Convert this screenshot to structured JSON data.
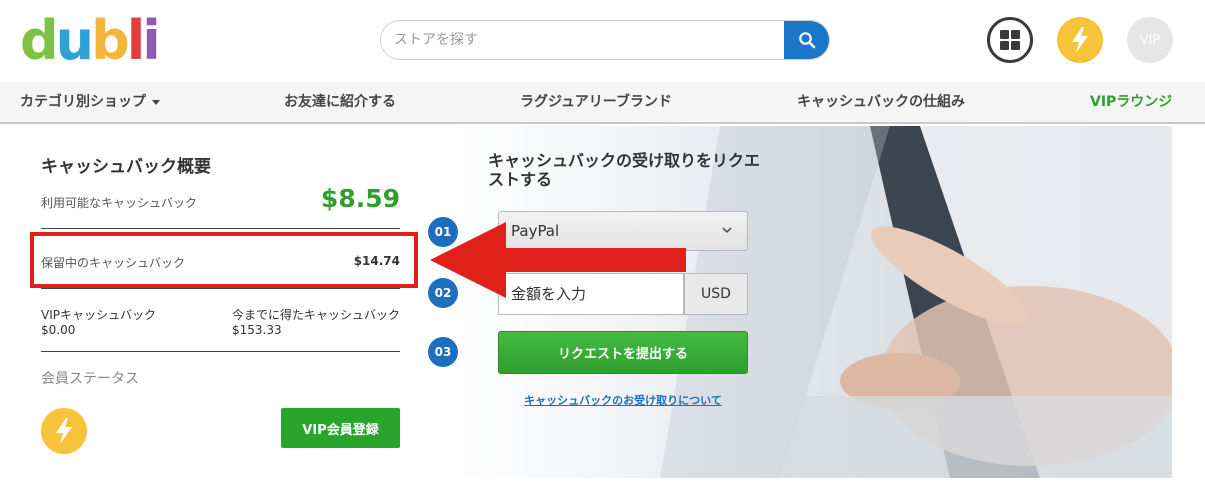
{
  "header": {
    "logo": [
      "d",
      "u",
      "b",
      "l",
      "i"
    ],
    "logo_colors": [
      "#7dc242",
      "#2fa0d8",
      "#f4b63a",
      "#e23c3c",
      "#8e5bb0"
    ],
    "search": {
      "placeholder": "ストアを探す"
    },
    "icons": [
      "search-icon",
      "grid-icon",
      "bolt-icon"
    ],
    "vip_label": "VIP"
  },
  "nav": {
    "items": [
      "カテゴリ別ショップ",
      "お友達に紹介する",
      "ラグジュアリーブランド",
      "キャッシュバックの仕組み",
      "VIPラウンジ"
    ]
  },
  "summary": {
    "title": "キャッシュバック概要",
    "available_label": "利用可能なキャッシュバック",
    "available_value": "$8.59",
    "pending_label": "保留中のキャッシュバック",
    "pending_value": "$14.74",
    "vip_label": "VIPキャッシュバック",
    "vip_value": "$0.00",
    "earned_label": "今までに得たキャッシュバック",
    "earned_value": "$153.33",
    "status_label": "会員ステータス",
    "vip_button": "VIP会員登録"
  },
  "request": {
    "title": "キャッシュバックの受け取りをリクエストする",
    "steps": [
      "01",
      "02",
      "03"
    ],
    "method_selected": "PayPal",
    "amount_placeholder": "金額を入力",
    "currency": "USD",
    "submit_label": "リクエストを提出する",
    "help_link": "キャッシュバックのお受け取りについて"
  },
  "colors": {
    "accent_green": "#2fa02e",
    "accent_blue": "#1976c9",
    "highlight_red": "#e0201b"
  }
}
